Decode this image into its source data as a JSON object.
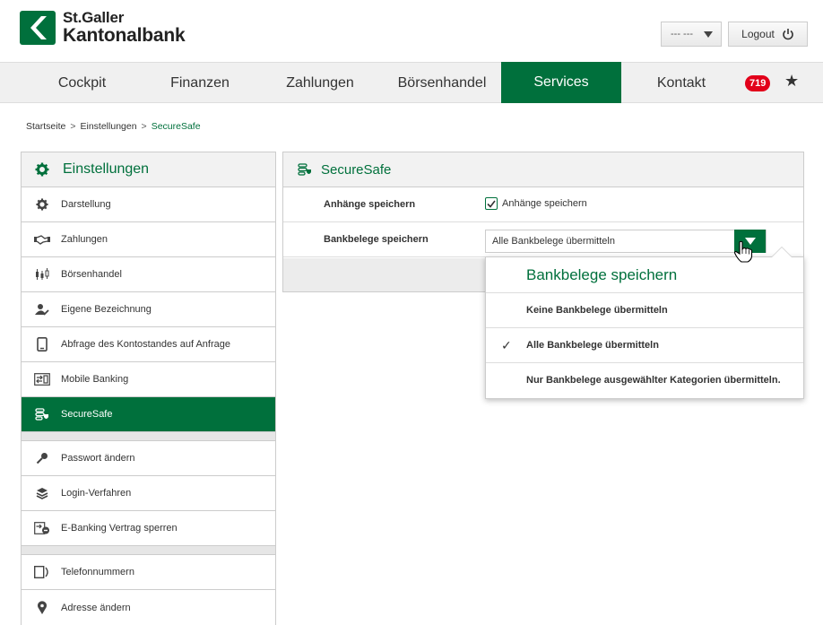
{
  "brand": {
    "line1": "St.Galler",
    "line2": "Kantonalbank",
    "color": "#00703c"
  },
  "header": {
    "select_value": "--- ---",
    "logout_label": "Logout"
  },
  "nav": {
    "items": [
      {
        "label": "Cockpit"
      },
      {
        "label": "Finanzen"
      },
      {
        "label": "Zahlungen"
      },
      {
        "label": "Börsenhandel"
      },
      {
        "label": "Services",
        "active": true
      },
      {
        "label": "Kontakt"
      }
    ],
    "badge": "719",
    "star_icon": "star-icon"
  },
  "breadcrumb": {
    "items": [
      "Startseite",
      "Einstellungen",
      "SecureSafe"
    ],
    "separator": ">"
  },
  "sidebar": {
    "title": "Einstellungen",
    "items": [
      {
        "label": "Darstellung",
        "icon": "gear-icon"
      },
      {
        "label": "Zahlungen",
        "icon": "handshake-icon"
      },
      {
        "label": "Börsenhandel",
        "icon": "candlestick-icon"
      },
      {
        "label": "Eigene Bezeichnung",
        "icon": "user-pen-icon"
      },
      {
        "label": "Abfrage des Kontostandes auf Anfrage",
        "icon": "phone-icon"
      },
      {
        "label": "Mobile Banking",
        "icon": "mobile-transfer-icon"
      },
      {
        "label": "SecureSafe",
        "icon": "securesafe-icon",
        "active": true
      },
      {
        "label": "Passwort ändern",
        "icon": "key-icon"
      },
      {
        "label": "Login-Verfahren",
        "icon": "layers-icon"
      },
      {
        "label": "E-Banking Vertrag sperren",
        "icon": "contract-lock-icon"
      },
      {
        "label": "Telefonnummern",
        "icon": "phone-number-icon"
      },
      {
        "label": "Adresse ändern",
        "icon": "map-pin-icon"
      }
    ]
  },
  "panel": {
    "title": "SecureSafe",
    "rows": {
      "attachments": {
        "label": "Anhänge speichern",
        "checkbox_label": "Anhänge speichern",
        "checked": true
      },
      "receipts": {
        "label": "Bankbelege speichern",
        "selected": "Alle Bankbelege übermitteln"
      }
    }
  },
  "dropdown": {
    "title": "Bankbelege speichern",
    "options": [
      {
        "label": "Keine Bankbelege übermitteln",
        "selected": false
      },
      {
        "label": "Alle Bankbelege übermitteln",
        "selected": true
      },
      {
        "label": "Nur Bankbelege ausgewählter Kategorien übermitteln.",
        "selected": false
      }
    ]
  }
}
